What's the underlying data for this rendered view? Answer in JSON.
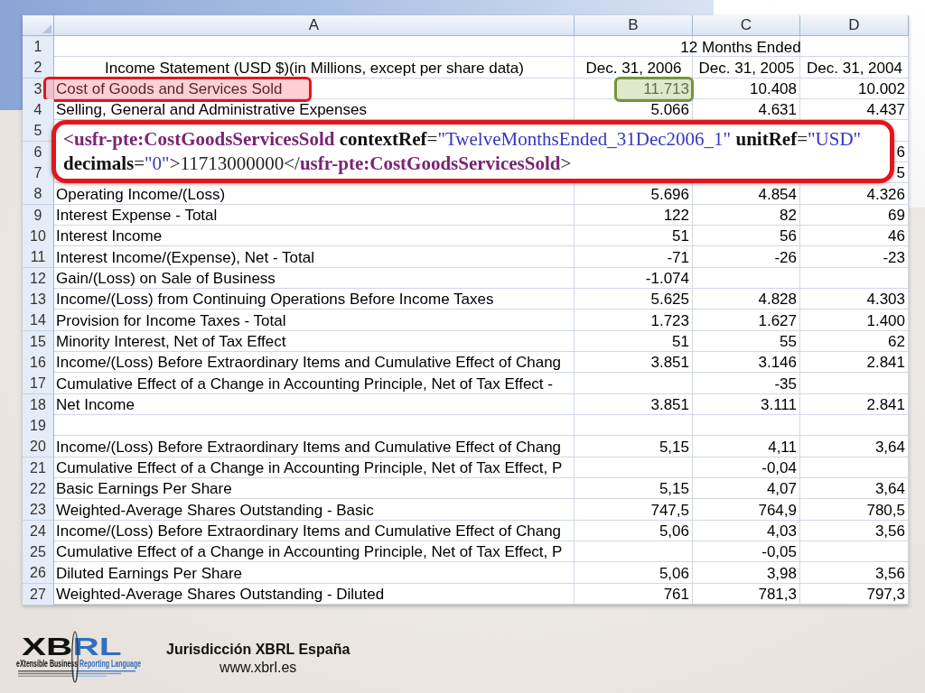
{
  "sheet": {
    "columns": [
      "A",
      "B",
      "C",
      "D"
    ],
    "rows": [
      {
        "number": "1",
        "kind": "merged",
        "span_text": "12 Months Ended",
        "label_framed": false,
        "value_framed": false
      },
      {
        "number": "2",
        "kind": "heading",
        "label": "Income Statement (USD $)(in Millions, except per share data)",
        "col_b": "Dec. 31, 2006",
        "col_c": "Dec. 31, 2005",
        "col_d": "Dec. 31, 2004",
        "label_framed": false,
        "value_framed": false
      },
      {
        "number": "3",
        "kind": "data",
        "label": "Cost of Goods and Services Sold",
        "col_b": "11.713",
        "col_c": "10.408",
        "col_d": "10.002",
        "label_framed": true,
        "value_framed": true
      },
      {
        "number": "4",
        "kind": "data",
        "label": "Selling, General and Administrative Expenses",
        "col_b": "5.066",
        "col_c": "4.631",
        "col_d": "4.437",
        "label_framed": false,
        "value_framed": false
      },
      {
        "number": "5",
        "kind": "data",
        "label_framed": false,
        "value_framed": false
      },
      {
        "number": "6",
        "kind": "data",
        "col_d": "6",
        "label_framed": false,
        "value_framed": false
      },
      {
        "number": "7",
        "kind": "data",
        "col_d": "5",
        "label_framed": false,
        "value_framed": false
      },
      {
        "number": "8",
        "kind": "data",
        "label": "Operating Income/(Loss)",
        "col_b": "5.696",
        "col_c": "4.854",
        "col_d": "4.326",
        "label_framed": false,
        "value_framed": false
      },
      {
        "number": "9",
        "kind": "data",
        "label": "Interest Expense - Total",
        "col_b": "122",
        "col_c": "82",
        "col_d": "69",
        "label_framed": false,
        "value_framed": false
      },
      {
        "number": "10",
        "kind": "data",
        "label": "Interest Income",
        "col_b": "51",
        "col_c": "56",
        "col_d": "46",
        "label_framed": false,
        "value_framed": false
      },
      {
        "number": "11",
        "kind": "data",
        "label": "Interest Income/(Expense), Net - Total",
        "col_b": "-71",
        "col_c": "-26",
        "col_d": "-23",
        "label_framed": false,
        "value_framed": false
      },
      {
        "number": "12",
        "kind": "data",
        "label": "Gain/(Loss) on Sale of Business",
        "col_b": "-1.074",
        "label_framed": false,
        "value_framed": false
      },
      {
        "number": "13",
        "kind": "data",
        "label": "Income/(Loss) from Continuing Operations Before Income Taxes",
        "col_b": "5.625",
        "col_c": "4.828",
        "col_d": "4.303",
        "label_framed": false,
        "value_framed": false
      },
      {
        "number": "14",
        "kind": "data",
        "label": "Provision for Income Taxes - Total",
        "col_b": "1.723",
        "col_c": "1.627",
        "col_d": "1.400",
        "label_framed": false,
        "value_framed": false
      },
      {
        "number": "15",
        "kind": "data",
        "label": "Minority Interest, Net of Tax Effect",
        "col_b": "51",
        "col_c": "55",
        "col_d": "62",
        "label_framed": false,
        "value_framed": false
      },
      {
        "number": "16",
        "kind": "data",
        "label": "Income/(Loss) Before Extraordinary Items and Cumulative Effect of Chang",
        "col_b": "3.851",
        "col_c": "3.146",
        "col_d": "2.841",
        "label_framed": false,
        "value_framed": false
      },
      {
        "number": "17",
        "kind": "data",
        "label": "Cumulative Effect of a Change in Accounting Principle, Net of Tax Effect -",
        "col_c": "-35",
        "label_framed": false,
        "value_framed": false
      },
      {
        "number": "18",
        "kind": "data",
        "label": "Net Income",
        "col_b": "3.851",
        "col_c": "3.111",
        "col_d": "2.841",
        "label_framed": false,
        "value_framed": false
      },
      {
        "number": "19",
        "kind": "data",
        "label_framed": false,
        "value_framed": false
      },
      {
        "number": "20",
        "kind": "data",
        "label": "Income/(Loss) Before Extraordinary Items and Cumulative Effect of Chang",
        "col_b": "5,15",
        "col_c": "4,11",
        "col_d": "3,64",
        "label_framed": false,
        "value_framed": false
      },
      {
        "number": "21",
        "kind": "data",
        "label": "Cumulative Effect of a Change in Accounting Principle, Net of Tax Effect, P",
        "col_c": "-0,04",
        "label_framed": false,
        "value_framed": false
      },
      {
        "number": "22",
        "kind": "data",
        "label": "Basic Earnings Per Share",
        "col_b": "5,15",
        "col_c": "4,07",
        "col_d": "3,64",
        "label_framed": false,
        "value_framed": false
      },
      {
        "number": "23",
        "kind": "data",
        "label": "Weighted-Average Shares Outstanding - Basic",
        "col_b": "747,5",
        "col_c": "764,9",
        "col_d": "780,5",
        "label_framed": false,
        "value_framed": false
      },
      {
        "number": "24",
        "kind": "data",
        "label": "Income/(Loss) Before Extraordinary Items and Cumulative Effect of Chang",
        "col_b": "5,06",
        "col_c": "4,03",
        "col_d": "3,56",
        "label_framed": false,
        "value_framed": false
      },
      {
        "number": "25",
        "kind": "data",
        "label": "Cumulative Effect of a Change in Accounting Principle, Net of Tax Effect, P",
        "col_c": "-0,05",
        "label_framed": false,
        "value_framed": false
      },
      {
        "number": "26",
        "kind": "data",
        "label": "Diluted Earnings Per Share",
        "col_b": "5,06",
        "col_c": "3,98",
        "col_d": "3,56",
        "label_framed": false,
        "value_framed": false
      },
      {
        "number": "27",
        "kind": "data",
        "label": "Weighted-Average Shares Outstanding - Diluted",
        "col_b": "761",
        "col_c": "781,3",
        "col_d": "797,3",
        "label_framed": false,
        "value_framed": false
      }
    ]
  },
  "callout": {
    "lines": [
      [
        {
          "kind": "tag",
          "text": "<usfr-pte:CostGoodsServicesSold"
        },
        {
          "kind": "attr",
          "text": " contextRef"
        },
        {
          "kind": "punct",
          "text": "="
        },
        {
          "kind": "value",
          "text": "\"TwelveMonthsEnded_31Dec2006_1\""
        },
        {
          "kind": "attr",
          "text": " unitRef"
        },
        {
          "kind": "punct",
          "text": "="
        },
        {
          "kind": "value",
          "text": "\"USD\""
        }
      ],
      [
        {
          "kind": "attr",
          "text": "decimals"
        },
        {
          "kind": "punct",
          "text": "="
        },
        {
          "kind": "value",
          "text": "\"0\""
        },
        {
          "kind": "punct",
          "text": ">11713000000</"
        },
        {
          "kind": "tag",
          "text": "usfr-pte:CostGoodsServicesSold"
        },
        {
          "kind": "punct",
          "text": ">"
        }
      ]
    ]
  },
  "footer": {
    "logo": {
      "wordmark": [
        "XB",
        "RL"
      ],
      "tagline": [
        "eXtensible Business",
        "Reporting Language"
      ]
    },
    "title": "Jurisdicción XBRL España",
    "url": "www.xbrl.es"
  }
}
